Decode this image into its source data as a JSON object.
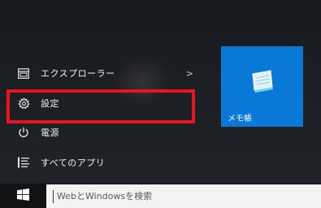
{
  "start_menu": {
    "items": [
      {
        "label": "エクスプローラー",
        "icon": "folder-explorer-icon",
        "has_submenu": true,
        "submenu_indicator": ">"
      },
      {
        "label": "設定",
        "icon": "gear-icon"
      },
      {
        "label": "電源",
        "icon": "power-icon"
      },
      {
        "label": "すべてのアプリ",
        "icon": "all-apps-list-icon"
      }
    ],
    "highlight_color": "#e8141e"
  },
  "tiles": [
    {
      "label": "メモ帳",
      "icon": "notepad-icon",
      "color": "#0a78d7"
    }
  ],
  "taskbar": {
    "start_icon": "windows-logo-icon",
    "search_placeholder": "WebとWindowsを検索"
  }
}
